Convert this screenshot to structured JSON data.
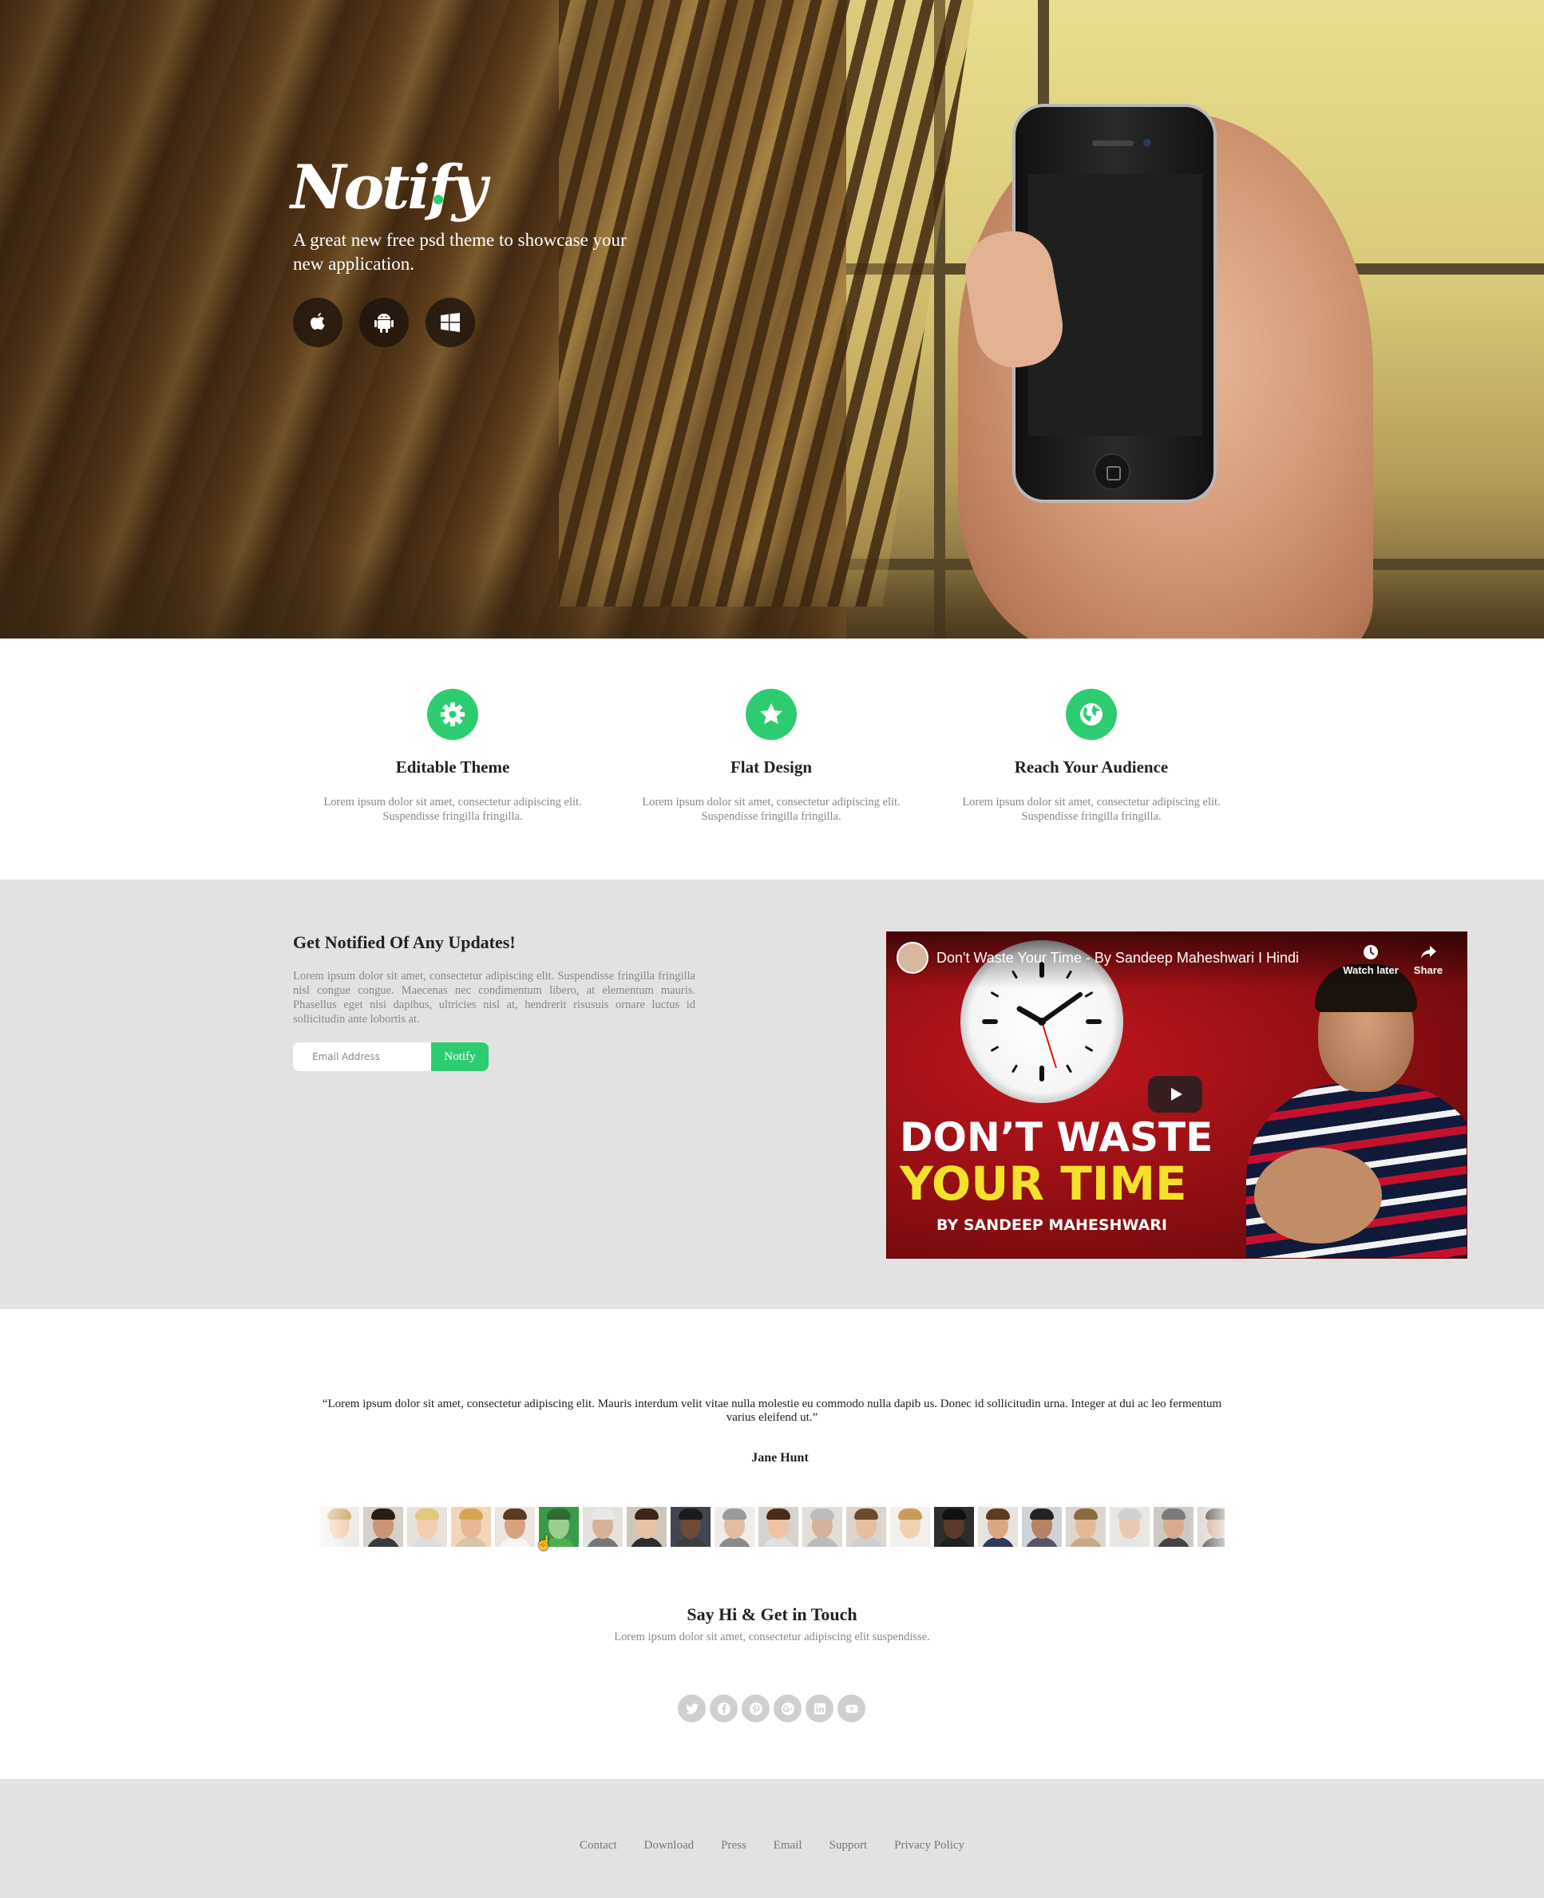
{
  "hero": {
    "brand": "Notify",
    "tagline": "A great new free psd theme to showcase your new application.",
    "platforms": [
      {
        "icon": "apple-icon"
      },
      {
        "icon": "android-icon"
      },
      {
        "icon": "windows-icon"
      }
    ]
  },
  "features": [
    {
      "icon": "gear-icon",
      "title": "Editable Theme",
      "text": "Lorem ipsum dolor sit amet, consectetur adipiscing elit. Suspendisse fringilla fringilla."
    },
    {
      "icon": "star-icon",
      "title": "Flat Design",
      "text": "Lorem ipsum dolor sit amet, consectetur adipiscing elit. Suspendisse fringilla fringilla."
    },
    {
      "icon": "globe-icon",
      "title": "Reach Your Audience",
      "text": "Lorem ipsum dolor sit amet, consectetur adipiscing elit. Suspendisse fringilla fringilla."
    }
  ],
  "notify": {
    "title": "Get Notified Of Any Updates!",
    "text": "Lorem ipsum dolor sit amet, consectetur adipiscing elit. Suspendisse fringilla fringilla nisl congue congue. Maecenas nec condimentum libero, at elementum mauris. Phasellus eget nisi dapibus, ultricies nisl at, hendrerit risusuis ornare luctus id sollicitudin ante lobortis at.",
    "email_placeholder": "Email Address",
    "button_label": "Notify"
  },
  "video": {
    "title": "Don't Waste Your Time - By Sandeep Maheshwari I Hindi",
    "watch_later": "Watch later",
    "share": "Share",
    "headline_line1": "DON’T WASTE",
    "headline_line2": "YOUR TIME",
    "byline": "BY SANDEEP MAHESHWARI"
  },
  "testimonial": {
    "quote": "“Lorem ipsum dolor sit amet, consectetur adipiscing elit. Mauris interdum velit vitae nulla molestie eu commodo nulla dapib us. Donec id sollicitudin urna. Integer at dui ac leo fermentum varius eleifend ut.”",
    "author": "Jane Hunt"
  },
  "contact": {
    "title": "Say Hi & Get in Touch",
    "text": "Lorem ipsum dolor sit amet, consectetur adipiscing elit suspendisse.",
    "socials": [
      "twitter-icon",
      "facebook-icon",
      "pinterest-icon",
      "google-plus-icon",
      "linkedin-icon",
      "youtube-icon"
    ]
  },
  "footer": {
    "links": [
      "Contact",
      "Download",
      "Press",
      "Email",
      "Support",
      "Privacy Policy"
    ]
  },
  "colors": {
    "accent": "#2ecc71",
    "section_gray": "#e2e2e2",
    "muted_text": "#888888"
  }
}
